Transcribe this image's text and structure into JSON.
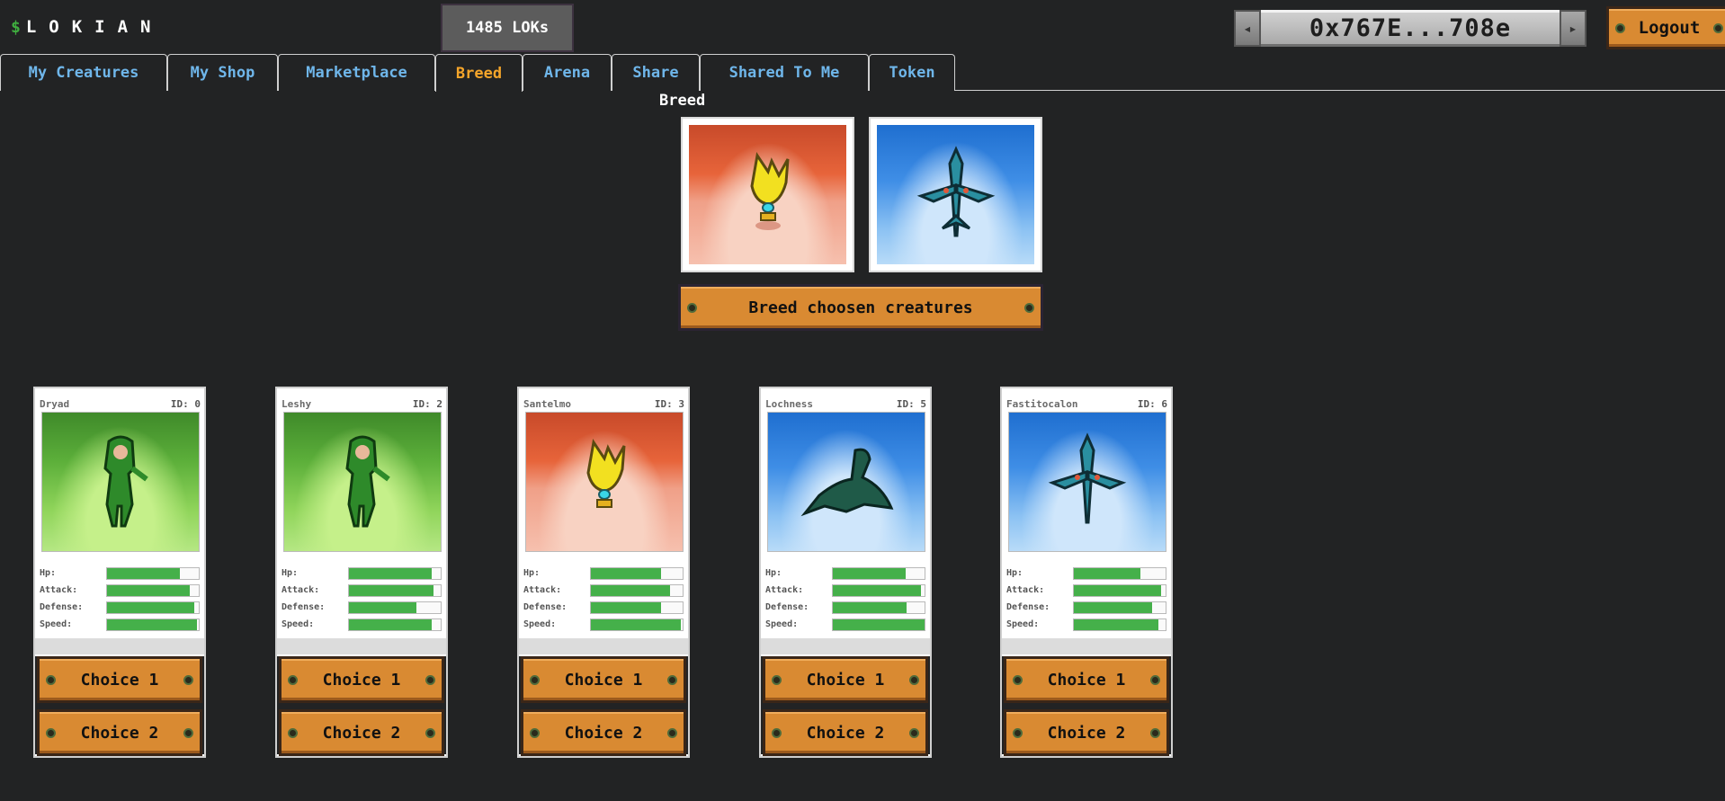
{
  "header": {
    "logo_icon": "$",
    "logo_text": "LOKIAN",
    "balance": "1485 LOKs",
    "wallet_address": "0x767E...708e",
    "logout_label": "Logout"
  },
  "tabs": [
    {
      "label": "My Creatures",
      "active": false
    },
    {
      "label": "My Shop",
      "active": false
    },
    {
      "label": "Marketplace",
      "active": false
    },
    {
      "label": "Breed",
      "active": true
    },
    {
      "label": "Arena",
      "active": false
    },
    {
      "label": "Share",
      "active": false
    },
    {
      "label": "Shared To Me",
      "active": false
    },
    {
      "label": "Token",
      "active": false
    }
  ],
  "breed": {
    "title": "Breed",
    "slot_1": {
      "habitat": "fire"
    },
    "slot_2": {
      "habitat": "water"
    },
    "button_label": "Breed choosen creatures"
  },
  "stat_labels": [
    "Hp:",
    "Attack:",
    "Defense:",
    "Speed:"
  ],
  "creatures": [
    {
      "name": "Dryad",
      "id_label": "ID: 0",
      "habitat": "grass",
      "stats": [
        0.79,
        0.9,
        0.95,
        0.98
      ]
    },
    {
      "name": "Leshy",
      "id_label": "ID: 2",
      "habitat": "grass",
      "stats": [
        0.9,
        0.92,
        0.74,
        0.9
      ]
    },
    {
      "name": "Santelmo",
      "id_label": "ID: 3",
      "habitat": "fire",
      "stats": [
        0.76,
        0.86,
        0.76,
        0.98
      ]
    },
    {
      "name": "Lochness",
      "id_label": "ID: 5",
      "habitat": "water",
      "stats": [
        0.79,
        0.96,
        0.8,
        1.0
      ]
    },
    {
      "name": "Fastitocalon",
      "id_label": "ID: 6",
      "habitat": "water",
      "stats": [
        0.73,
        0.95,
        0.85,
        0.92
      ]
    }
  ],
  "choice_1_label": "Choice 1",
  "choice_2_label": "Choice 2",
  "colors": {
    "background": "#222324",
    "tab_text": "#6fb6ea",
    "tab_active": "#f5a52a",
    "button_wood": "#d98a32",
    "stat_bar": "#45b04a"
  }
}
